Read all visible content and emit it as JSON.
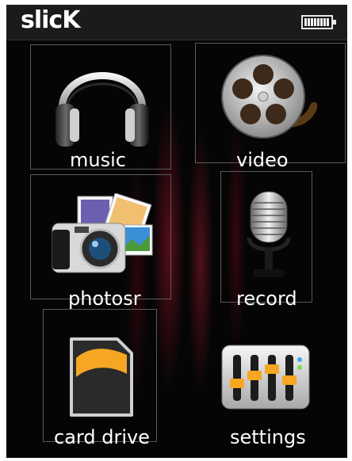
{
  "header": {
    "brand": "slicK",
    "battery_icon": "battery-full-icon"
  },
  "menu": {
    "music": {
      "label": "music",
      "icon": "headphones-icon"
    },
    "video": {
      "label": "video",
      "icon": "film-reel-icon"
    },
    "photos": {
      "label": "photosr",
      "icon": "camera-photos-icon"
    },
    "record": {
      "label": "record",
      "icon": "microphone-icon"
    },
    "card_drive": {
      "label": "card drive",
      "icon": "sd-card-icon"
    },
    "settings": {
      "label": "settings",
      "icon": "equalizer-sliders-icon"
    }
  },
  "colors": {
    "background": "#050505",
    "text": "#ffffff",
    "accent_orange": "#f5a623"
  }
}
